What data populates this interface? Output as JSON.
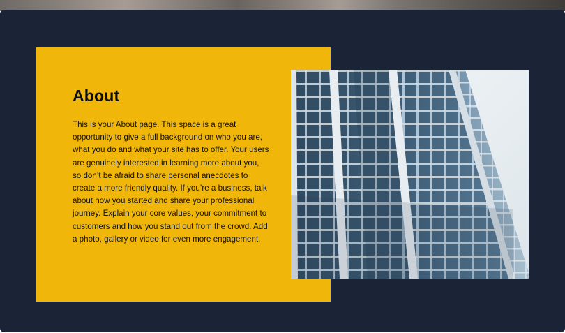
{
  "about": {
    "title": "About",
    "body": "This is your About page. This space is a great opportunity to give a full background on who you are, what you do and what your site has to offer. Your users are genuinely interested in learning more about you, so don’t be afraid to share personal anecdotes to create a more friendly quality. If you’re a business, talk about how you started and share your professional journey. Explain your core values, your commitment to customers and how you stand out from the crowd. Add a photo, gallery or video for even more engagement."
  },
  "colors": {
    "section_background": "#1a2436",
    "card_background": "#f0b70a",
    "text": "#111111"
  },
  "images": {
    "about_photo": "glass-office-building-image"
  }
}
